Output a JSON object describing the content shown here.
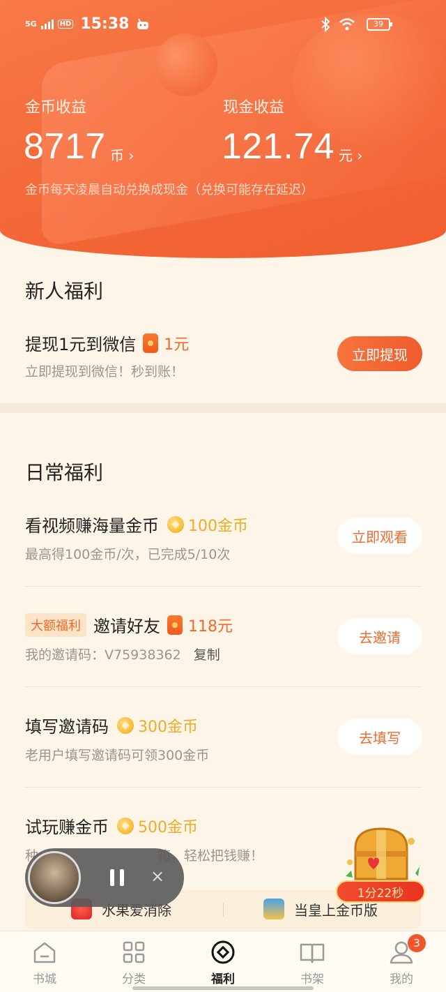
{
  "status_bar": {
    "network": "5G",
    "hd": "HD",
    "time": "15:38",
    "battery": "39"
  },
  "earnings": {
    "coin_label": "金币收益",
    "coin_value": "8717",
    "coin_unit": "币 ›",
    "cash_label": "现金收益",
    "cash_value": "121.74",
    "cash_unit": "元 ›",
    "note": "金币每天凌晨自动兑换成现金（兑换可能存在延迟）"
  },
  "newbie": {
    "section_title": "新人福利",
    "task_title": "提现1元到微信",
    "reward": "1元",
    "desc": "立即提现到微信！秒到账！",
    "button": "立即提现"
  },
  "daily": {
    "section_title": "日常福利",
    "tasks": [
      {
        "title": "看视频赚海量金币",
        "reward": "100金币",
        "desc": "最高得100金币/次，已完成5/10次",
        "button": "立即观看"
      },
      {
        "tag": "大额福利",
        "title": "邀请好友",
        "reward": "118元",
        "desc": "我的邀请码：V75938362",
        "copy": "复制",
        "button": "去邀请"
      },
      {
        "title": "填写邀请码",
        "reward": "300金币",
        "desc": "老用户填写邀请码可领300金币",
        "button": "去填写"
      },
      {
        "title": "试玩赚金币",
        "reward": "500金币",
        "desc_visible": "种",
        "desc_tail": "箱，轻松把钱赚！"
      }
    ]
  },
  "games": [
    {
      "name": "水果爱消除"
    },
    {
      "name": "当皇上金币版"
    }
  ],
  "chest_timer": "1分22秒",
  "nav": [
    {
      "label": "书城"
    },
    {
      "label": "分类"
    },
    {
      "label": "福利"
    },
    {
      "label": "书架"
    },
    {
      "label": "我的",
      "badge": "3"
    }
  ],
  "colors": {
    "header_orange": "#f46a3a",
    "accent": "#ef6a2c",
    "gold": "#efac2a",
    "background": "#fdf5e7"
  }
}
